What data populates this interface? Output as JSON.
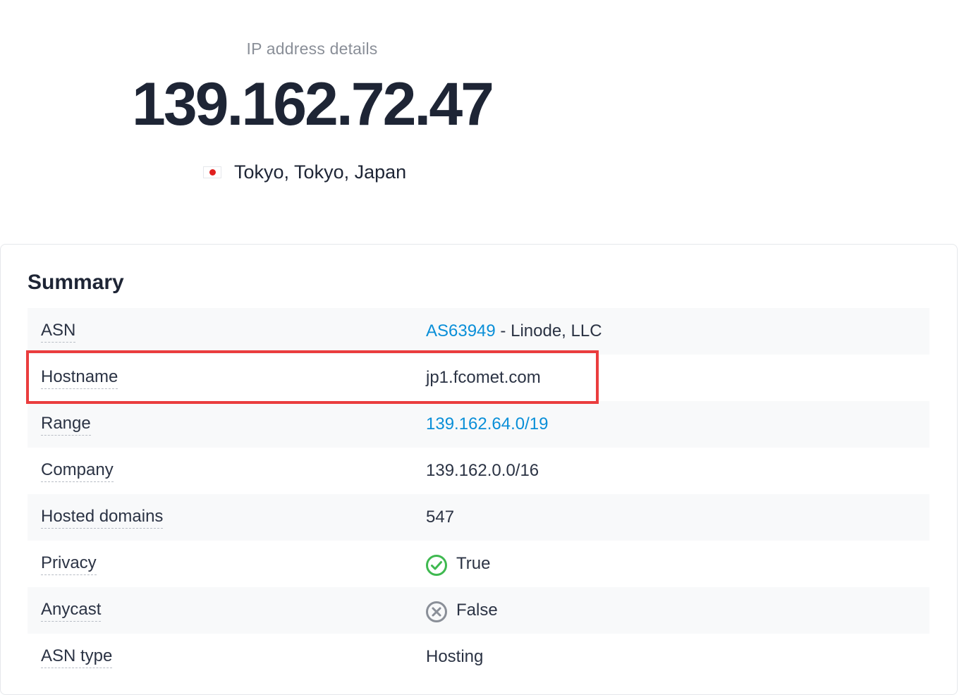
{
  "header": {
    "subtitle": "IP address details",
    "ip": "139.162.72.47",
    "location": "Tokyo, Tokyo, Japan",
    "flag_icon": "japan-flag-icon"
  },
  "summary": {
    "title": "Summary",
    "asn": {
      "label": "ASN",
      "link_text": "AS63949",
      "rest": " - Linode, LLC"
    },
    "hostname": {
      "label": "Hostname",
      "value": "jp1.fcomet.com"
    },
    "range": {
      "label": "Range",
      "value": "139.162.64.0/19"
    },
    "company": {
      "label": "Company",
      "value": "139.162.0.0/16"
    },
    "hosted_domains": {
      "label": "Hosted domains",
      "value": "547"
    },
    "privacy": {
      "label": "Privacy",
      "value": "True",
      "icon": "check-circle-icon"
    },
    "anycast": {
      "label": "Anycast",
      "value": "False",
      "icon": "x-circle-icon"
    },
    "asn_type": {
      "label": "ASN type",
      "value": "Hosting"
    }
  },
  "colors": {
    "link": "#0a8fd8",
    "highlight": "#ea3d3e",
    "check": "#3fb950",
    "cross": "#8a8f98"
  }
}
